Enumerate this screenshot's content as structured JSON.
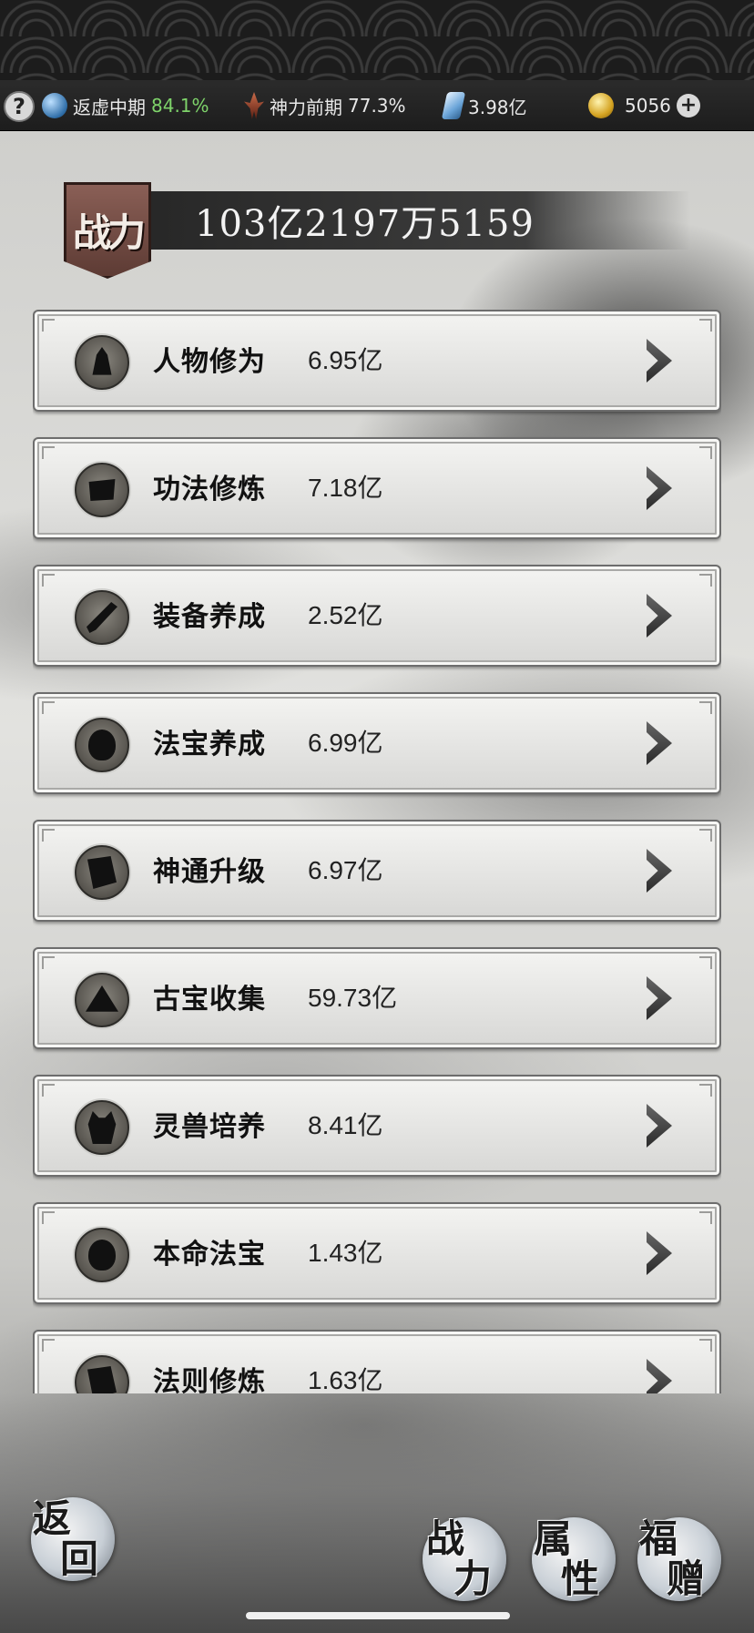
{
  "resource_bar": {
    "help_label": "?",
    "realm": {
      "icon": "yin-yang-orb-icon",
      "label": "返虚中期",
      "percent": "84.1%"
    },
    "divine": {
      "icon": "divine-power-icon",
      "label": "神力前期",
      "percent": "77.3%"
    },
    "crystal": {
      "icon": "spirit-crystal-icon",
      "value": "3.98亿"
    },
    "gold": {
      "icon": "gold-coin-icon",
      "value": "5056",
      "add_label": "+"
    }
  },
  "power": {
    "banner_label": "战力",
    "total": "103亿2197万5159"
  },
  "rows": [
    {
      "label": "人物修为",
      "value": "6.95亿",
      "icon": "cultivator-icon"
    },
    {
      "label": "功法修炼",
      "value": "7.18亿",
      "icon": "technique-book-icon"
    },
    {
      "label": "装备养成",
      "value": "2.52亿",
      "icon": "equipment-icon"
    },
    {
      "label": "法宝养成",
      "value": "6.99亿",
      "icon": "treasure-gourd-icon"
    },
    {
      "label": "神通升级",
      "value": "6.97亿",
      "icon": "divine-scroll-icon"
    },
    {
      "label": "古宝收集",
      "value": "59.73亿",
      "icon": "ancient-treasure-icon"
    },
    {
      "label": "灵兽培养",
      "value": "8.41亿",
      "icon": "spirit-beast-icon"
    },
    {
      "label": "本命法宝",
      "value": "1.43亿",
      "icon": "natal-treasure-icon"
    },
    {
      "label": "法则修炼",
      "value": "1.63亿",
      "icon": "law-scroll-icon"
    }
  ],
  "bottom": {
    "back_label_1": "返",
    "back_label_2": "回",
    "tab_power_1": "战",
    "tab_power_2": "力",
    "tab_attr_1": "属",
    "tab_attr_2": "性",
    "tab_gift_1": "福",
    "tab_gift_2": "赠"
  }
}
